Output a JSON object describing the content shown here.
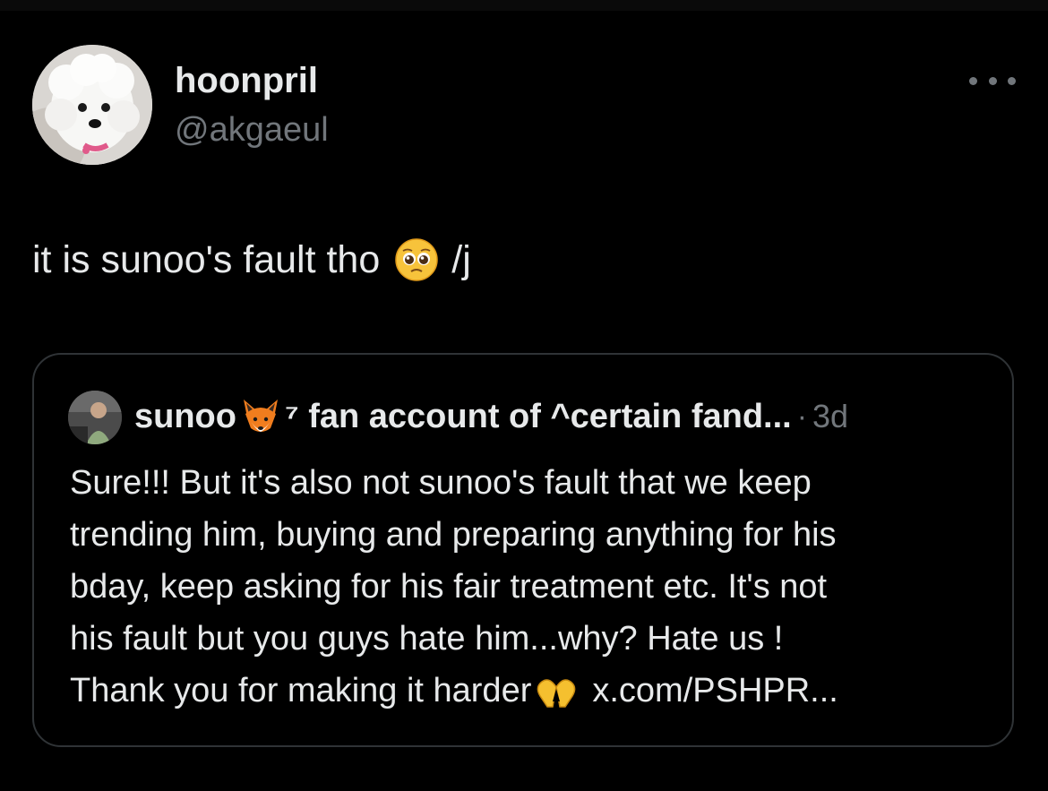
{
  "tweet": {
    "display_name": "hoonpril",
    "handle": "@akgaeul",
    "text_before_emoji": "it is sunoo's fault tho",
    "emoji": "pleading-face",
    "text_after_emoji": "/j"
  },
  "quote": {
    "name": "sunoo",
    "name_emoji": "fox-face",
    "name_suffix": "⁷ fan account of ^certain fand...",
    "separator": "·",
    "time": "3d",
    "body_lines": [
      "Sure!!! But it's also not sunoo's fault that we keep",
      "trending him, buying and preparing anything for his",
      "bday, keep asking for his fair treatment etc. It's not",
      "his fault but you guys hate him...why? Hate us !"
    ],
    "last_line_text": "Thank you for making it harder",
    "last_line_emoji": "heart-hands",
    "link": "x.com/PSHPR..."
  },
  "colors": {
    "background": "#000000",
    "primary_text": "#e7e9ea",
    "secondary_text": "#71767b",
    "border": "#2f3336"
  }
}
